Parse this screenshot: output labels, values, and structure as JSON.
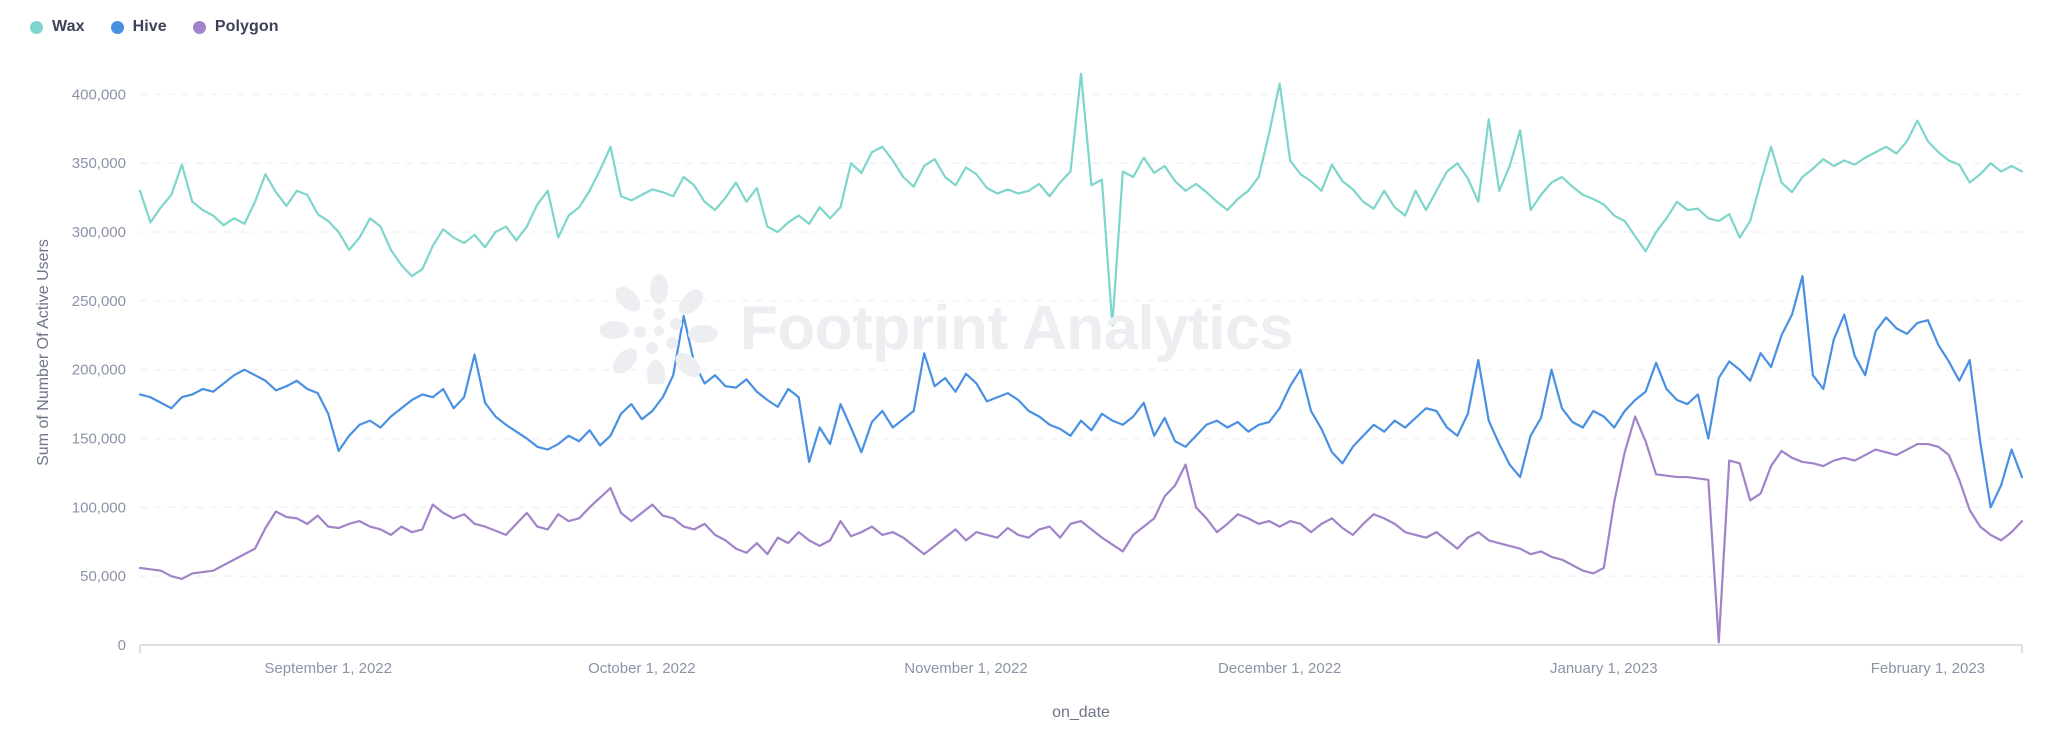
{
  "legend": {
    "position": "top-left",
    "items": [
      {
        "label": "Wax",
        "color": "#7ed5cb",
        "icon": "legend-dot-icon"
      },
      {
        "label": "Hive",
        "color": "#4a90e2",
        "icon": "legend-dot-icon"
      },
      {
        "label": "Polygon",
        "color": "#a183c9",
        "icon": "legend-dot-icon"
      }
    ]
  },
  "watermark": {
    "text": "Footprint Analytics",
    "color": "#eceef1",
    "logo_icon": "footprint-flower-logo-icon"
  },
  "colors": {
    "wax": "#7ed5cb",
    "hive": "#4a90e2",
    "polygon": "#a183c9",
    "axis_text": "#8b93a7",
    "axis_line": "#cfd3dc",
    "gridline": "#f1f2f5",
    "background": "#ffffff"
  },
  "chart_data": {
    "type": "line",
    "title": "",
    "subtitle": "",
    "xlabel": "on_date",
    "ylabel": "Sum of Number Of Active Users",
    "grid": true,
    "legend_position": "top-left",
    "ylim": [
      0,
      425000
    ],
    "ytick_values": [
      0,
      50000,
      100000,
      150000,
      200000,
      250000,
      300000,
      350000,
      400000
    ],
    "ytick_labels": [
      "0",
      "50,000",
      "100,000",
      "150,000",
      "200,000",
      "250,000",
      "300,000",
      "350,000",
      "400,000"
    ],
    "xlim": [
      "2022-08-14",
      "2023-02-10"
    ],
    "xtick_labels": [
      "September 1, 2022",
      "October 1, 2022",
      "November 1, 2022",
      "December 1, 2022",
      "January 1, 2023",
      "February 1, 2023"
    ],
    "xtick_positions": [
      "2022-09-01",
      "2022-10-01",
      "2022-11-01",
      "2022-12-01",
      "2023-01-01",
      "2023-02-01"
    ],
    "x": [
      "2022-08-14",
      "2022-08-15",
      "2022-08-16",
      "2022-08-17",
      "2022-08-18",
      "2022-08-19",
      "2022-08-20",
      "2022-08-21",
      "2022-08-22",
      "2022-08-23",
      "2022-08-24",
      "2022-08-25",
      "2022-08-26",
      "2022-08-27",
      "2022-08-28",
      "2022-08-29",
      "2022-08-30",
      "2022-08-31",
      "2022-09-01",
      "2022-09-02",
      "2022-09-03",
      "2022-09-04",
      "2022-09-05",
      "2022-09-06",
      "2022-09-07",
      "2022-09-08",
      "2022-09-09",
      "2022-09-10",
      "2022-09-11",
      "2022-09-12",
      "2022-09-13",
      "2022-09-14",
      "2022-09-15",
      "2022-09-16",
      "2022-09-17",
      "2022-09-18",
      "2022-09-19",
      "2022-09-20",
      "2022-09-21",
      "2022-09-22",
      "2022-09-23",
      "2022-09-24",
      "2022-09-25",
      "2022-09-26",
      "2022-09-27",
      "2022-09-28",
      "2022-09-29",
      "2022-09-30",
      "2022-10-01",
      "2022-10-02",
      "2022-10-03",
      "2022-10-04",
      "2022-10-05",
      "2022-10-06",
      "2022-10-07",
      "2022-10-08",
      "2022-10-09",
      "2022-10-10",
      "2022-10-11",
      "2022-10-12",
      "2022-10-13",
      "2022-10-14",
      "2022-10-15",
      "2022-10-16",
      "2022-10-17",
      "2022-10-18",
      "2022-10-19",
      "2022-10-20",
      "2022-10-21",
      "2022-10-22",
      "2022-10-23",
      "2022-10-24",
      "2022-10-25",
      "2022-10-26",
      "2022-10-27",
      "2022-10-28",
      "2022-10-29",
      "2022-10-30",
      "2022-10-31",
      "2022-11-01",
      "2022-11-02",
      "2022-11-03",
      "2022-11-04",
      "2022-11-05",
      "2022-11-06",
      "2022-11-07",
      "2022-11-08",
      "2022-11-09",
      "2022-11-10",
      "2022-11-11",
      "2022-11-12",
      "2022-11-13",
      "2022-11-14",
      "2022-11-15",
      "2022-11-16",
      "2022-11-17",
      "2022-11-18",
      "2022-11-19",
      "2022-11-20",
      "2022-11-21",
      "2022-11-22",
      "2022-11-23",
      "2022-11-24",
      "2022-11-25",
      "2022-11-26",
      "2022-11-27",
      "2022-11-28",
      "2022-11-29",
      "2022-11-30",
      "2022-12-01",
      "2022-12-02",
      "2022-12-03",
      "2022-12-04",
      "2022-12-05",
      "2022-12-06",
      "2022-12-07",
      "2022-12-08",
      "2022-12-09",
      "2022-12-10",
      "2022-12-11",
      "2022-12-12",
      "2022-12-13",
      "2022-12-14",
      "2022-12-15",
      "2022-12-16",
      "2022-12-17",
      "2022-12-18",
      "2022-12-19",
      "2022-12-20",
      "2022-12-21",
      "2022-12-22",
      "2022-12-23",
      "2022-12-24",
      "2022-12-25",
      "2022-12-26",
      "2022-12-27",
      "2022-12-28",
      "2022-12-29",
      "2022-12-30",
      "2022-12-31",
      "2023-01-01",
      "2023-01-02",
      "2023-01-03",
      "2023-01-04",
      "2023-01-05",
      "2023-01-06",
      "2023-01-07",
      "2023-01-08",
      "2023-01-09",
      "2023-01-10",
      "2023-01-11",
      "2023-01-12",
      "2023-01-13",
      "2023-01-14",
      "2023-01-15",
      "2023-01-16",
      "2023-01-17",
      "2023-01-18",
      "2023-01-19",
      "2023-01-20",
      "2023-01-21",
      "2023-01-22",
      "2023-01-23",
      "2023-01-24",
      "2023-01-25",
      "2023-01-26",
      "2023-01-27",
      "2023-01-28",
      "2023-01-29",
      "2023-01-30",
      "2023-01-31",
      "2023-02-01",
      "2023-02-02",
      "2023-02-03",
      "2023-02-04",
      "2023-02-05",
      "2023-02-06",
      "2023-02-07",
      "2023-02-08",
      "2023-02-09",
      "2023-02-10"
    ],
    "series": [
      {
        "name": "Wax",
        "color": "#7ed5cb",
        "values": [
          330000,
          307000,
          318000,
          327000,
          349000,
          322000,
          316000,
          312000,
          305000,
          310000,
          306000,
          322000,
          342000,
          329000,
          319000,
          330000,
          327000,
          313000,
          308000,
          300000,
          287000,
          296000,
          310000,
          304000,
          287000,
          276000,
          268000,
          273000,
          290000,
          302000,
          296000,
          292000,
          298000,
          289000,
          300000,
          304000,
          294000,
          304000,
          320000,
          330000,
          296000,
          312000,
          318000,
          330000,
          345000,
          362000,
          326000,
          323000,
          327000,
          331000,
          329000,
          326000,
          340000,
          334000,
          322000,
          316000,
          325000,
          336000,
          322000,
          332000,
          304000,
          300000,
          307000,
          312000,
          306000,
          318000,
          310000,
          318000,
          350000,
          343000,
          358000,
          362000,
          352000,
          340000,
          333000,
          348000,
          353000,
          340000,
          334000,
          347000,
          342000,
          332000,
          328000,
          331000,
          328000,
          330000,
          335000,
          326000,
          336000,
          344000,
          415000,
          334000,
          338000,
          232000,
          344000,
          340000,
          354000,
          343000,
          348000,
          337000,
          330000,
          335000,
          329000,
          322000,
          316000,
          324000,
          330000,
          340000,
          372000,
          408000,
          352000,
          342000,
          337000,
          330000,
          349000,
          337000,
          331000,
          322000,
          317000,
          330000,
          318000,
          312000,
          330000,
          316000,
          330000,
          344000,
          350000,
          339000,
          322000,
          382000,
          330000,
          348000,
          374000,
          316000,
          327000,
          336000,
          340000,
          333000,
          327000,
          324000,
          320000,
          312000,
          308000,
          297000,
          286000,
          300000,
          310000,
          322000,
          316000,
          317000,
          310000,
          308000,
          313000,
          296000,
          308000,
          336000,
          362000,
          336000,
          329000,
          340000,
          346000,
          353000,
          348000,
          352000,
          349000,
          354000,
          358000,
          362000,
          357000,
          366000,
          381000,
          366000,
          358000,
          352000,
          349000,
          336000,
          342000,
          350000,
          344000,
          348000,
          344000
        ]
      },
      {
        "name": "Hive",
        "color": "#4a90e2",
        "values": [
          182000,
          180000,
          176000,
          172000,
          180000,
          182000,
          186000,
          184000,
          190000,
          196000,
          200000,
          196000,
          192000,
          185000,
          188000,
          192000,
          186000,
          183000,
          168000,
          141000,
          152000,
          160000,
          163000,
          158000,
          166000,
          172000,
          178000,
          182000,
          180000,
          186000,
          172000,
          180000,
          211000,
          176000,
          166000,
          160000,
          155000,
          150000,
          144000,
          142000,
          146000,
          152000,
          148000,
          156000,
          145000,
          152000,
          168000,
          175000,
          164000,
          170000,
          180000,
          196000,
          239000,
          205000,
          190000,
          196000,
          188000,
          187000,
          193000,
          184000,
          178000,
          173000,
          186000,
          180000,
          133000,
          158000,
          146000,
          175000,
          158000,
          140000,
          162000,
          170000,
          158000,
          164000,
          170000,
          212000,
          188000,
          194000,
          184000,
          197000,
          190000,
          177000,
          180000,
          183000,
          178000,
          170000,
          166000,
          160000,
          157000,
          152000,
          163000,
          156000,
          168000,
          163000,
          160000,
          166000,
          176000,
          152000,
          165000,
          148000,
          144000,
          152000,
          160000,
          163000,
          158000,
          162000,
          155000,
          160000,
          162000,
          172000,
          188000,
          200000,
          170000,
          157000,
          140000,
          132000,
          144000,
          152000,
          160000,
          155000,
          163000,
          158000,
          165000,
          172000,
          170000,
          158000,
          152000,
          168000,
          207000,
          163000,
          146000,
          131000,
          122000,
          152000,
          165000,
          200000,
          172000,
          162000,
          158000,
          170000,
          166000,
          158000,
          170000,
          178000,
          184000,
          205000,
          186000,
          178000,
          175000,
          182000,
          150000,
          194000,
          206000,
          200000,
          192000,
          212000,
          202000,
          225000,
          240000,
          268000,
          196000,
          186000,
          222000,
          240000,
          210000,
          196000,
          228000,
          238000,
          230000,
          226000,
          234000,
          236000,
          218000,
          206000,
          192000,
          207000,
          148000,
          100000,
          116000,
          142000,
          122000
        ]
      },
      {
        "name": "Polygon",
        "color": "#a183c9",
        "values": [
          56000,
          55000,
          54000,
          50000,
          48000,
          52000,
          53000,
          54000,
          58000,
          62000,
          66000,
          70000,
          85000,
          97000,
          93000,
          92000,
          88000,
          94000,
          86000,
          85000,
          88000,
          90000,
          86000,
          84000,
          80000,
          86000,
          82000,
          84000,
          102000,
          96000,
          92000,
          95000,
          88000,
          86000,
          83000,
          80000,
          88000,
          96000,
          86000,
          84000,
          95000,
          90000,
          92000,
          100000,
          107000,
          114000,
          96000,
          90000,
          96000,
          102000,
          94000,
          92000,
          86000,
          84000,
          88000,
          80000,
          76000,
          70000,
          67000,
          74000,
          66000,
          78000,
          74000,
          82000,
          76000,
          72000,
          76000,
          90000,
          79000,
          82000,
          86000,
          80000,
          82000,
          78000,
          72000,
          66000,
          72000,
          78000,
          84000,
          76000,
          82000,
          80000,
          78000,
          85000,
          80000,
          78000,
          84000,
          86000,
          78000,
          88000,
          90000,
          84000,
          78000,
          73000,
          68000,
          80000,
          86000,
          92000,
          108000,
          116000,
          131000,
          100000,
          92000,
          82000,
          88000,
          95000,
          92000,
          88000,
          90000,
          86000,
          90000,
          88000,
          82000,
          88000,
          92000,
          85000,
          80000,
          88000,
          95000,
          92000,
          88000,
          82000,
          80000,
          78000,
          82000,
          76000,
          70000,
          78000,
          82000,
          76000,
          74000,
          72000,
          70000,
          66000,
          68000,
          64000,
          62000,
          58000,
          54000,
          52000,
          56000,
          104000,
          140000,
          166000,
          148000,
          124000,
          123000,
          122000,
          122000,
          121000,
          120000,
          2000,
          134000,
          132000,
          105000,
          110000,
          130000,
          141000,
          136000,
          133000,
          132000,
          130000,
          134000,
          136000,
          134000,
          138000,
          142000,
          140000,
          138000,
          142000,
          146000,
          146000,
          144000,
          138000,
          120000,
          98000,
          86000,
          80000,
          76000,
          82000,
          90000
        ]
      }
    ]
  }
}
